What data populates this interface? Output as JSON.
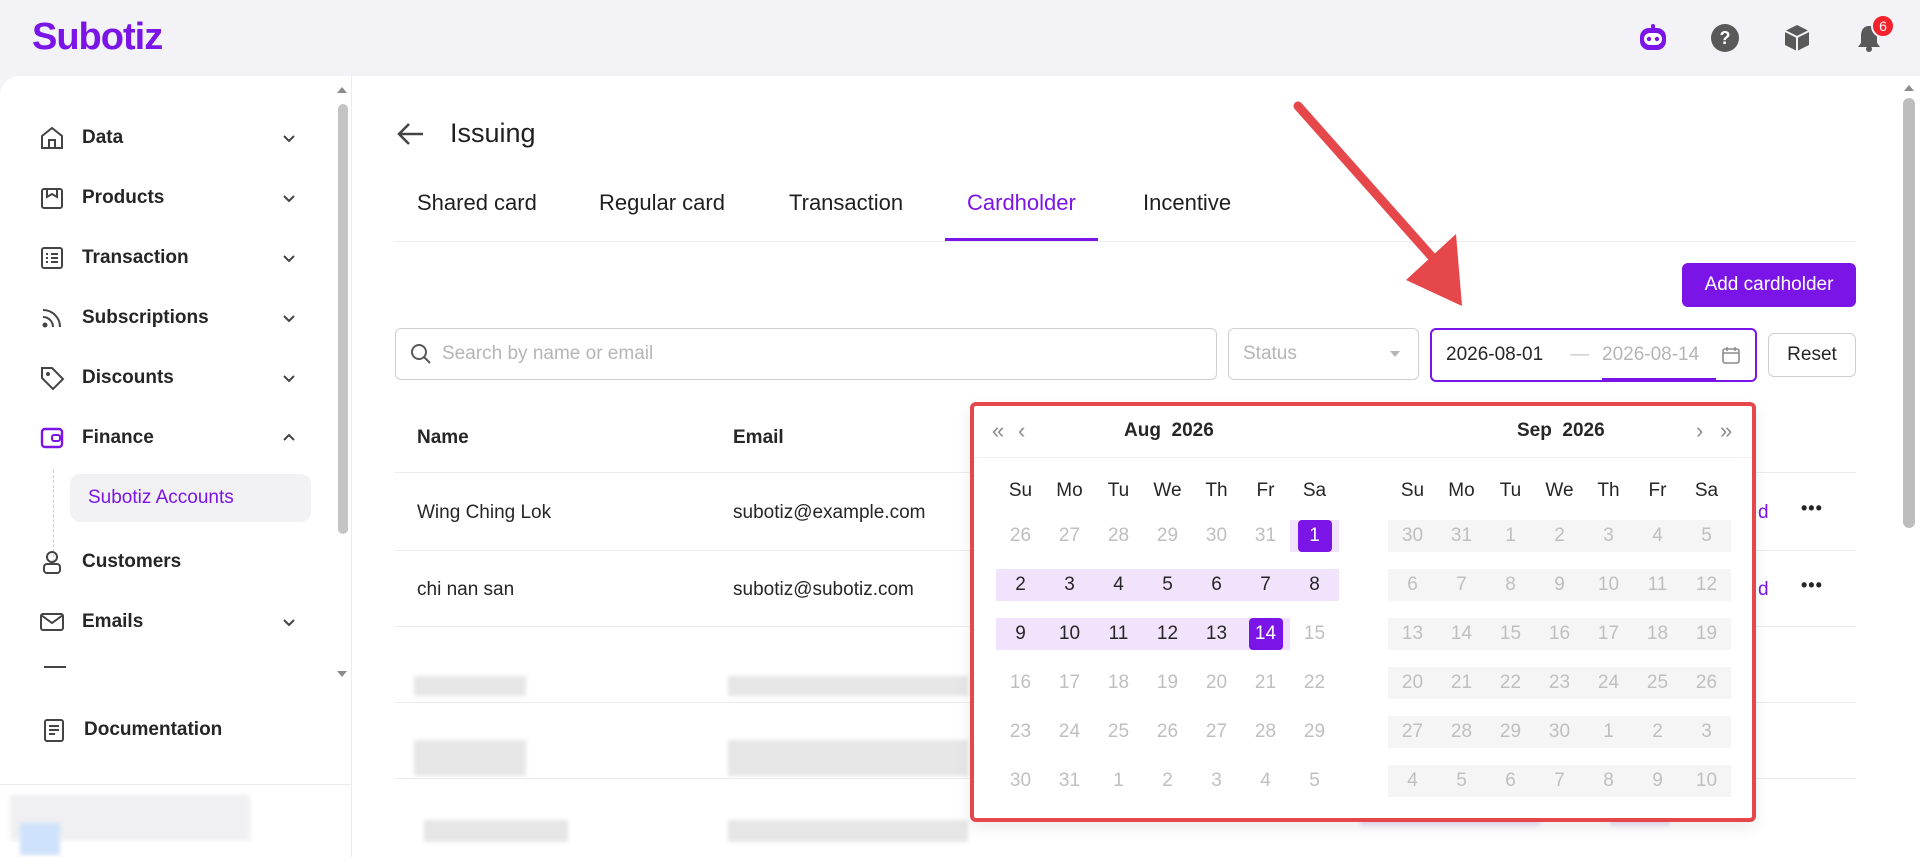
{
  "app": {
    "logo": "Subotiz",
    "notification_count": "6"
  },
  "top_icons": [
    "bot-icon",
    "help-icon",
    "package-icon",
    "bell-icon"
  ],
  "sidebar": {
    "items": [
      {
        "label": "Data",
        "icon": "home-icon",
        "expandable": true
      },
      {
        "label": "Products",
        "icon": "store-icon",
        "expandable": true
      },
      {
        "label": "Transaction",
        "icon": "list-icon",
        "expandable": true
      },
      {
        "label": "Subscriptions",
        "icon": "rss-icon",
        "expandable": true
      },
      {
        "label": "Discounts",
        "icon": "tag-icon",
        "expandable": true
      },
      {
        "label": "Finance",
        "icon": "wallet-icon",
        "expanded": true
      },
      {
        "label": "Customers",
        "icon": "user-icon",
        "expandable": false
      },
      {
        "label": "Emails",
        "icon": "mail-icon",
        "expandable": true
      }
    ],
    "sub_item": "Subotiz Accounts",
    "footer_item": "Documentation"
  },
  "page": {
    "title": "Issuing",
    "tabs": [
      {
        "label": "Shared card"
      },
      {
        "label": "Regular card"
      },
      {
        "label": "Transaction"
      },
      {
        "label": "Cardholder",
        "active": true
      },
      {
        "label": "Incentive"
      }
    ],
    "add_button": "Add cardholder"
  },
  "filters": {
    "search_placeholder": "Search by name or email",
    "status_placeholder": "Status",
    "date_start": "2026-08-01",
    "date_separator": "—",
    "date_end": "2026-08-14",
    "reset": "Reset"
  },
  "table": {
    "columns": [
      "Name",
      "Email"
    ],
    "rows": [
      {
        "name": "Wing Ching Lok",
        "email": "subotiz@example.com",
        "link_fragment": "d"
      },
      {
        "name": "chi nan san",
        "email": "subotiz@subotiz.com",
        "link_fragment": "d"
      }
    ]
  },
  "datepicker": {
    "weekdays": [
      "Su",
      "Mo",
      "Tu",
      "We",
      "Th",
      "Fr",
      "Sa"
    ],
    "left": {
      "month": "Aug",
      "year": "2026"
    },
    "right": {
      "month": "Sep",
      "year": "2026"
    },
    "selected_start": "1",
    "selected_end": "14"
  },
  "colors": {
    "brand": "#7b14e6",
    "annotation": "#e5474a",
    "badge": "#f5222d"
  }
}
